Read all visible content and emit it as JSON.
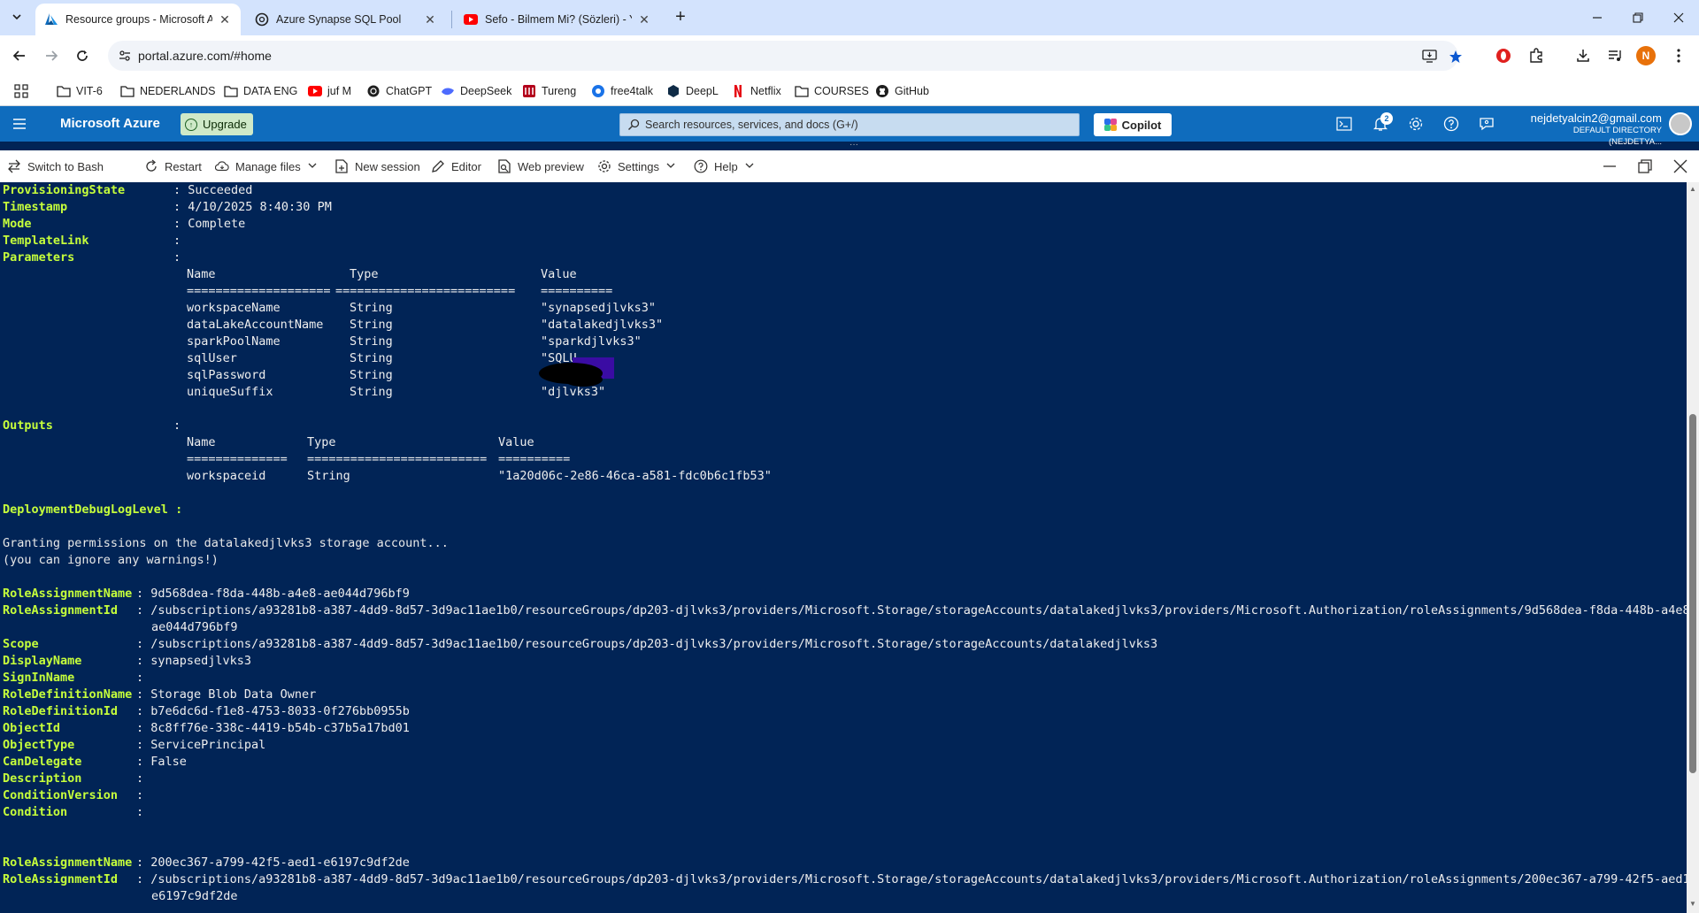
{
  "browser": {
    "tabs": [
      {
        "title": "Resource groups - Microsoft Azure",
        "active": true
      },
      {
        "title": "Azure Synapse SQL Pool",
        "active": false
      },
      {
        "title": "Sefo - Bilmem Mi? (Sözleri) - YouTube",
        "active": false
      }
    ],
    "url": "portal.azure.com/#home",
    "profile_initial": "N",
    "bookmarks": [
      "VIT-6",
      "NEDERLANDS",
      "DATA ENG",
      "juf M",
      "ChatGPT",
      "DeepSeek",
      "Tureng",
      "free4talk",
      "DeepL",
      "Netflix",
      "COURSES",
      "GitHub"
    ]
  },
  "azure": {
    "brand": "Microsoft Azure",
    "upgrade_label": "Upgrade",
    "search_placeholder": "Search resources, services, and docs (G+/)",
    "copilot_label": "Copilot",
    "notifications_count": "2",
    "account_email": "nejdetyalcin2@gmail.com",
    "account_directory": "DEFAULT DIRECTORY (NEJDETYA..."
  },
  "shell_toolbar": {
    "switch": "Switch to Bash",
    "restart": "Restart",
    "manage_files": "Manage files",
    "new_session": "New session",
    "editor": "Editor",
    "web_preview": "Web preview",
    "settings": "Settings",
    "help": "Help"
  },
  "terminal": {
    "deployment": [
      {
        "key": "ProvisioningState",
        "value": "Succeeded"
      },
      {
        "key": "Timestamp",
        "value": "4/10/2025 8:40:30 PM"
      },
      {
        "key": "Mode",
        "value": "Complete"
      },
      {
        "key": "TemplateLink",
        "value": ""
      },
      {
        "key": "Parameters",
        "value": ""
      }
    ],
    "params_headers": [
      "Name",
      "Type",
      "Value"
    ],
    "params_rules": [
      "====================",
      "=========================",
      "=========="
    ],
    "params": [
      {
        "name": "workspaceName",
        "type": "String",
        "value": "\"synapsedjlvks3\""
      },
      {
        "name": "dataLakeAccountName",
        "type": "String",
        "value": "\"datalakedjlvks3\""
      },
      {
        "name": "sparkPoolName",
        "type": "String",
        "value": "\"sparkdjlvks3\""
      },
      {
        "name": "sqlUser",
        "type": "String",
        "value": "\"SQLU"
      },
      {
        "name": "sqlPassword",
        "type": "String",
        "value": ""
      },
      {
        "name": "uniqueSuffix",
        "type": "String",
        "value": "\"djlvks3\""
      }
    ],
    "outputs_key": "Outputs",
    "outputs_headers": [
      "Name",
      "Type",
      "Value"
    ],
    "outputs_rules": [
      "==============",
      "=========================",
      "=========="
    ],
    "outputs": [
      {
        "name": "workspaceid",
        "type": "String",
        "value": "\"1a20d06c-2e86-46ca-a581-fdc0b6c1fb53\""
      }
    ],
    "debug_key": "DeploymentDebugLogLevel :",
    "message1": "Granting permissions on the datalakedjlvks3 storage account...",
    "message2": "(you can ignore any warnings!)",
    "role1": [
      {
        "key": "RoleAssignmentName",
        "value": "9d568dea-f8da-448b-a4e8-ae044d796bf9"
      },
      {
        "key": "RoleAssignmentId",
        "value": "/subscriptions/a93281b8-a387-4dd9-8d57-3d9ac11ae1b0/resourceGroups/dp203-djlvks3/providers/Microsoft.Storage/storageAccounts/datalakedjlvks3/providers/Microsoft.Authorization/roleAssignments/9d568dea-f8da-448b-a4e8-"
      },
      {
        "key": "",
        "value": "ae044d796bf9"
      },
      {
        "key": "Scope",
        "value": "/subscriptions/a93281b8-a387-4dd9-8d57-3d9ac11ae1b0/resourceGroups/dp203-djlvks3/providers/Microsoft.Storage/storageAccounts/datalakedjlvks3"
      },
      {
        "key": "DisplayName",
        "value": "synapsedjlvks3"
      },
      {
        "key": "SignInName",
        "value": ""
      },
      {
        "key": "RoleDefinitionName",
        "value": "Storage Blob Data Owner"
      },
      {
        "key": "RoleDefinitionId",
        "value": "b7e6dc6d-f1e8-4753-8033-0f276bb0955b"
      },
      {
        "key": "ObjectId",
        "value": "8c8ff76e-338c-4419-b54b-c37b5a17bd01"
      },
      {
        "key": "ObjectType",
        "value": "ServicePrincipal"
      },
      {
        "key": "CanDelegate",
        "value": "False"
      },
      {
        "key": "Description",
        "value": ""
      },
      {
        "key": "ConditionVersion",
        "value": ""
      },
      {
        "key": "Condition",
        "value": ""
      }
    ],
    "role2": [
      {
        "key": "RoleAssignmentName",
        "value": "200ec367-a799-42f5-aed1-e6197c9df2de"
      },
      {
        "key": "RoleAssignmentId",
        "value": "/subscriptions/a93281b8-a387-4dd9-8d57-3d9ac11ae1b0/resourceGroups/dp203-djlvks3/providers/Microsoft.Storage/storageAccounts/datalakedjlvks3/providers/Microsoft.Authorization/roleAssignments/200ec367-a799-42f5-aed1-"
      },
      {
        "key": "",
        "value": "e6197c9df2de"
      }
    ]
  }
}
